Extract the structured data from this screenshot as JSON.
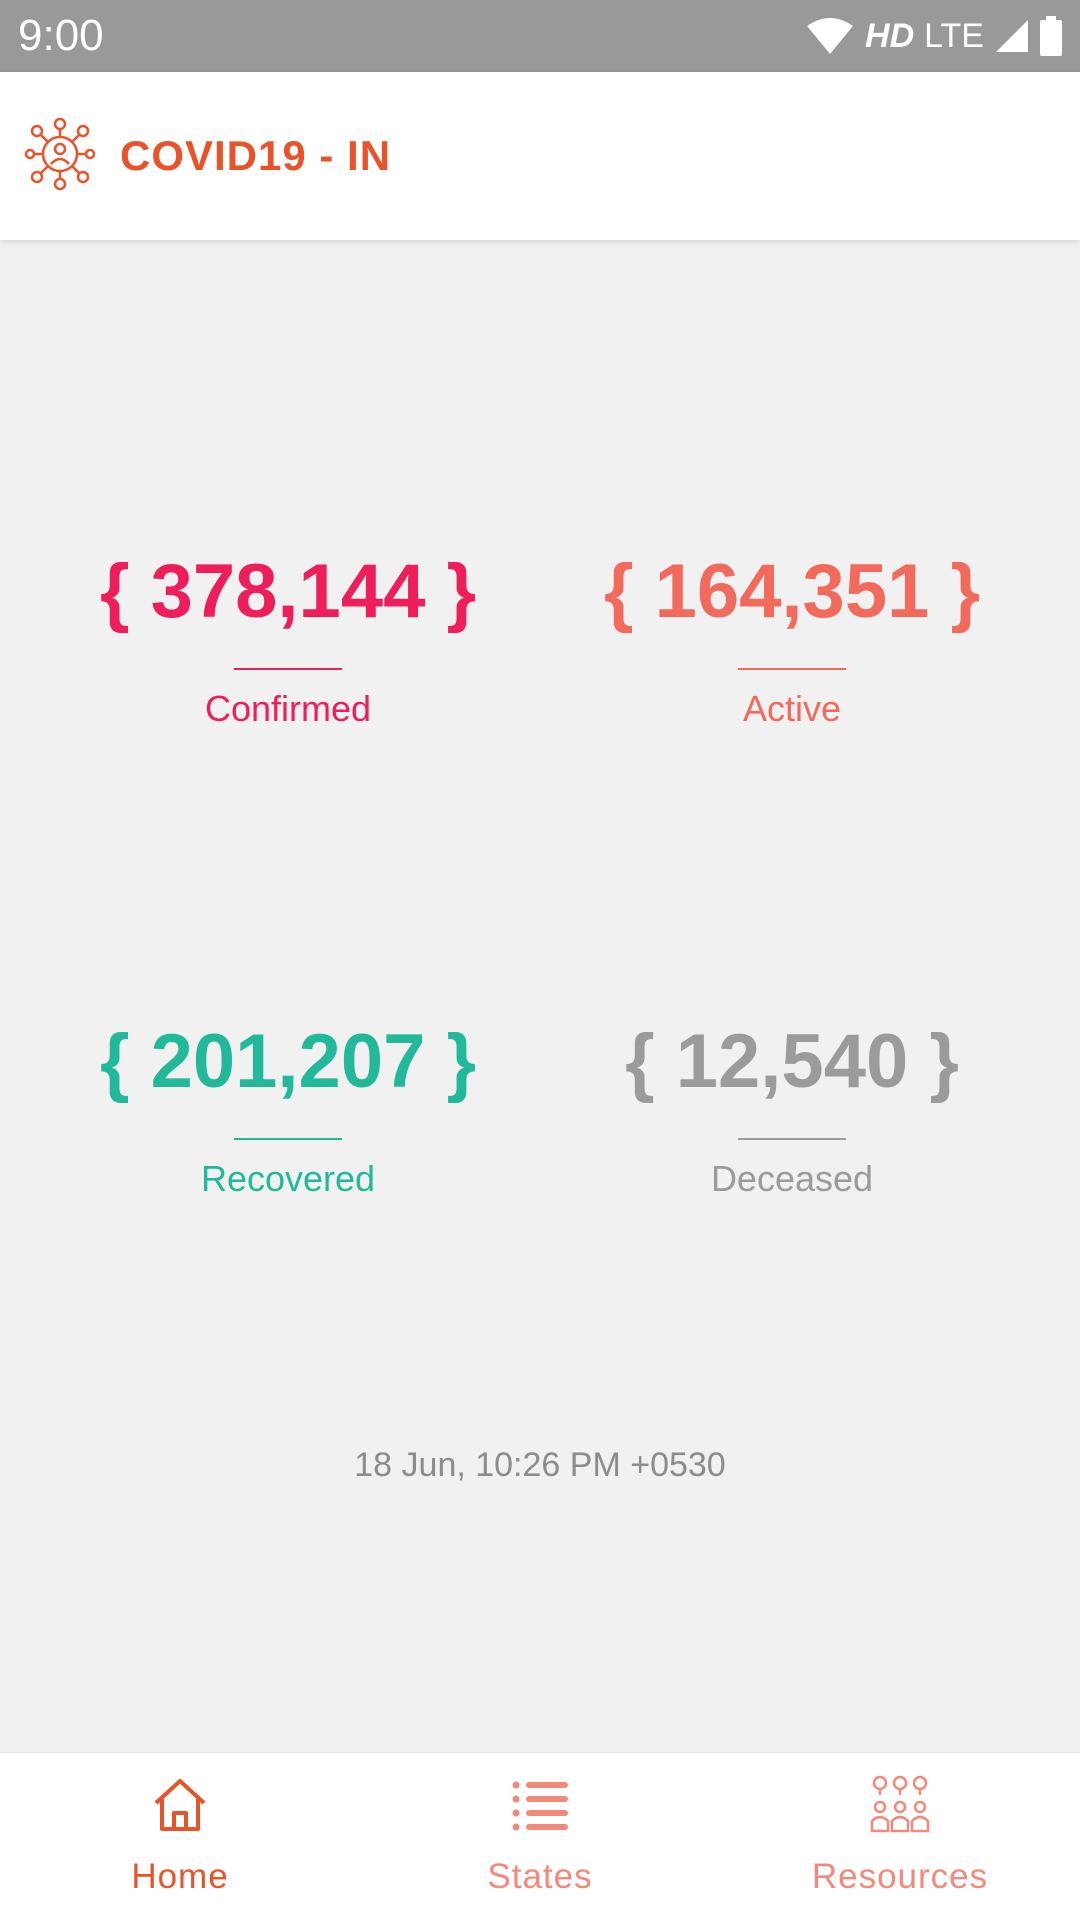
{
  "status_bar": {
    "time": "9:00",
    "network": "HD",
    "lte": "LTE",
    "icons": [
      "wifi-icon",
      "signal-icon",
      "battery-icon"
    ]
  },
  "app_bar": {
    "title": "COVID19 - IN",
    "logo_icon": "virus-network-icon",
    "accent": "#e8532a"
  },
  "stats": {
    "confirmed": {
      "value": "{ 378,144 }",
      "label": "Confirmed",
      "color": "#ed1e5a"
    },
    "active": {
      "value": "{ 164,351 }",
      "label": "Active",
      "color": "#f26a5c"
    },
    "recovered": {
      "value": "{ 201,207 }",
      "label": "Recovered",
      "color": "#22b99a"
    },
    "deceased": {
      "value": "{ 12,540 }",
      "label": "Deceased",
      "color": "#9b9b9b"
    }
  },
  "last_updated": "18 Jun, 10:26 PM +0530",
  "bottom_nav": {
    "items": [
      {
        "label": "Home",
        "icon": "home-icon",
        "active": true
      },
      {
        "label": "States",
        "icon": "list-icon",
        "active": false
      },
      {
        "label": "Resources",
        "icon": "people-icon",
        "active": false
      }
    ]
  }
}
